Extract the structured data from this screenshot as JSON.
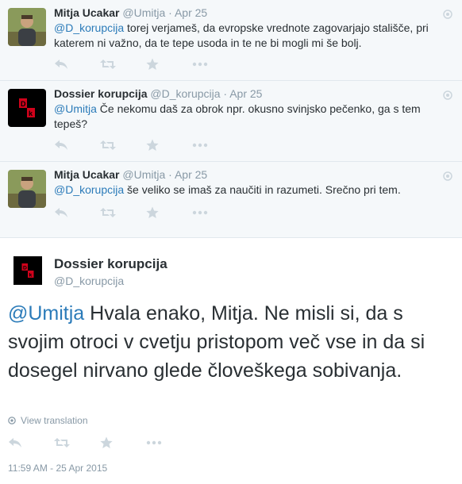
{
  "replies": [
    {
      "name": "Mitja Ucakar",
      "handle": "@Umitja",
      "sep": "·",
      "time": "Apr 25",
      "mention": "@D_korupcija",
      "text": " torej verjameš, da evropske vrednote zagovarjajo stališče, pri katerem ni važno, da te tepe usoda in te ne bi mogli mi še bolj.",
      "avatar_icon": "person-photo"
    },
    {
      "name": "Dossier korupcija",
      "handle": "@D_korupcija",
      "sep": "·",
      "time": "Apr 25",
      "mention": "@Umitja",
      "text": " Če nekomu daš za obrok npr. okusno svinjsko pečenko, ga s tem tepeš?",
      "avatar_icon": "dk-logo"
    },
    {
      "name": "Mitja Ucakar",
      "handle": "@Umitja",
      "sep": "·",
      "time": "Apr 25",
      "mention": "@D_korupcija",
      "text": " še veliko se imaš za naučiti in razumeti. Srečno pri tem.",
      "avatar_icon": "person-photo"
    }
  ],
  "main_tweet": {
    "name": "Dossier korupcija",
    "handle": "@D_korupcija",
    "mention": "@Umitja",
    "text": " Hvala enako, Mitja. Ne misli si, da s svojim otroci v cvetju pristopom več vse in da si dosegel nirvano glede človeškega sobivanja.",
    "view_translation": "View translation",
    "timestamp": "11:59 AM - 25 Apr 2015"
  },
  "icons": [
    "reply-icon",
    "retweet-icon",
    "favorite-icon",
    "more-icon",
    "globe-icon",
    "conversation-icon"
  ],
  "colors": {
    "link": "#2b7bb9",
    "muted": "#8899a6",
    "reply_bg": "#f5f8fa",
    "icon": "#ccd6dd",
    "logo_red": "#d0021b"
  }
}
